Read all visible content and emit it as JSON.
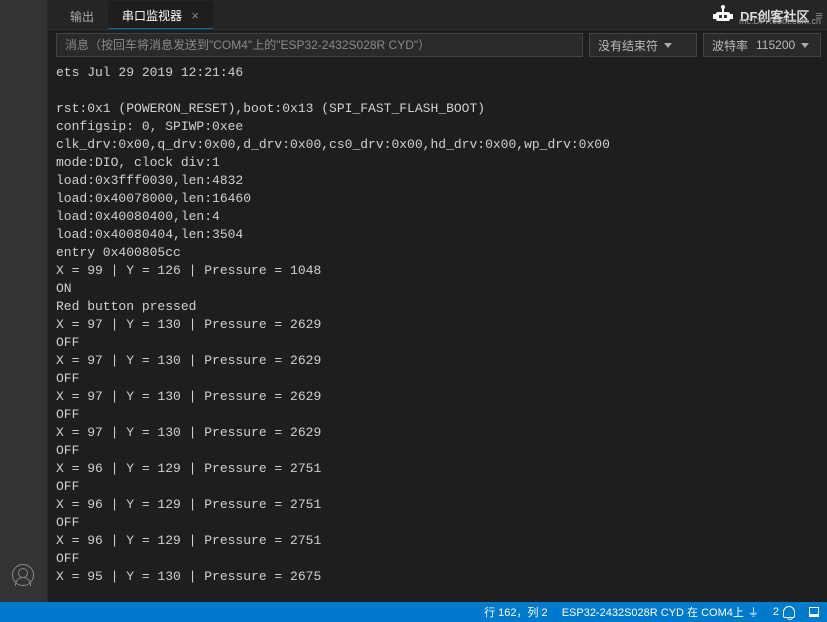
{
  "tabs": {
    "output": "输出",
    "serial": "串口监视器"
  },
  "brand": {
    "title": "DF创客社区",
    "sub": "mc.DFRobot.com.cn"
  },
  "toolbar": {
    "msg_placeholder": "消息（按回车将消息发送到\"COM4\"上的\"ESP32-2432S028R CYD\"）",
    "line_ending_label": "没有结束符",
    "baud_label": "波特率",
    "baud_value": "115200"
  },
  "console": {
    "text": "ets Jul 29 2019 12:21:46\n\nrst:0x1 (POWERON_RESET),boot:0x13 (SPI_FAST_FLASH_BOOT)\nconfigsip: 0, SPIWP:0xee\nclk_drv:0x00,q_drv:0x00,d_drv:0x00,cs0_drv:0x00,hd_drv:0x00,wp_drv:0x00\nmode:DIO, clock div:1\nload:0x3fff0030,len:4832\nload:0x40078000,len:16460\nload:0x40080400,len:4\nload:0x40080404,len:3504\nentry 0x400805cc\nX = 99 | Y = 126 | Pressure = 1048\nON\nRed button pressed\nX = 97 | Y = 130 | Pressure = 2629\nOFF\nX = 97 | Y = 130 | Pressure = 2629\nOFF\nX = 97 | Y = 130 | Pressure = 2629\nOFF\nX = 97 | Y = 130 | Pressure = 2629\nOFF\nX = 96 | Y = 129 | Pressure = 2751\nOFF\nX = 96 | Y = 129 | Pressure = 2751\nOFF\nX = 96 | Y = 129 | Pressure = 2751\nOFF\nX = 95 | Y = 130 | Pressure = 2675"
  },
  "status": {
    "cursor": "行 162，列 2",
    "board": "ESP32-2432S028R CYD 在 COM4上",
    "notif_count": "2"
  }
}
